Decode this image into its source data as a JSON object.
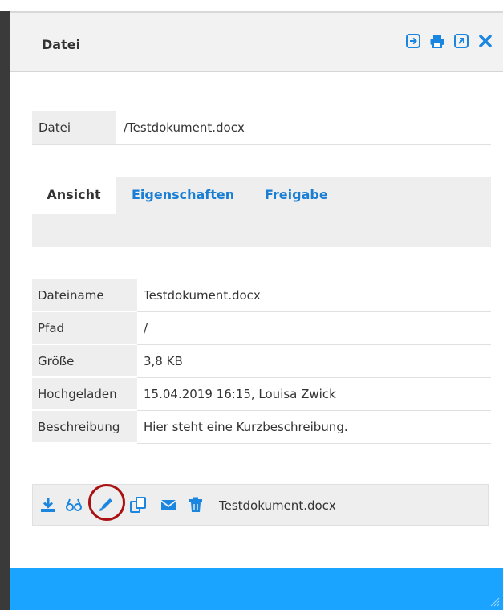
{
  "header": {
    "title": "Datei",
    "icons": [
      "login-icon",
      "print-icon",
      "external-link-icon",
      "close-icon"
    ]
  },
  "file": {
    "label": "Datei",
    "path": "/Testdokument.docx"
  },
  "tabs": [
    {
      "label": "Ansicht",
      "active": true
    },
    {
      "label": "Eigenschaften",
      "active": false
    },
    {
      "label": "Freigabe",
      "active": false
    }
  ],
  "meta": {
    "rows": [
      {
        "key": "Dateiname",
        "value": "Testdokument.docx"
      },
      {
        "key": "Pfad",
        "value": "/"
      },
      {
        "key": "Größe",
        "value": "3,8 KB"
      },
      {
        "key": "Hochgeladen",
        "value": "15.04.2019 16:15, Louisa Zwick"
      },
      {
        "key": "Beschreibung",
        "value": "Hier steht eine Kurzbeschreibung."
      }
    ]
  },
  "actions": {
    "icons": [
      "download-icon",
      "preview-icon",
      "edit-icon",
      "copy-icon",
      "email-icon",
      "trash-icon"
    ],
    "filename": "Testdokument.docx"
  },
  "colors": {
    "accent": "#1a86e0",
    "footer": "#1aa3ff",
    "highlight_circle": "#aa1111"
  }
}
